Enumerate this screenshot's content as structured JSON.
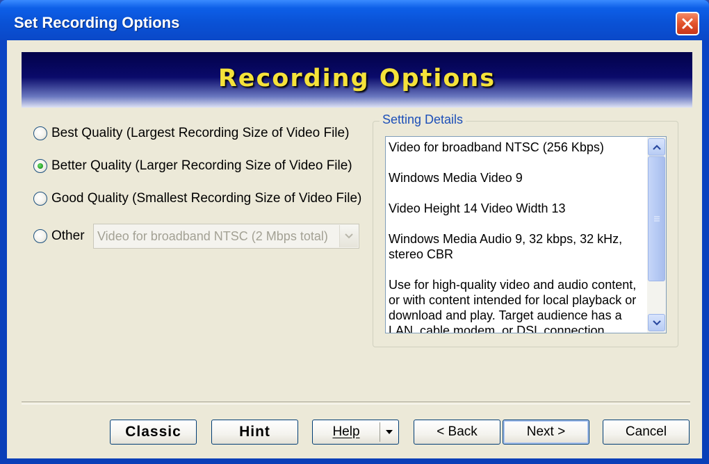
{
  "window": {
    "title": "Set Recording Options"
  },
  "banner": {
    "title": "Recording Options"
  },
  "options": {
    "best": {
      "label": "Best Quality (Largest Recording Size of Video File)",
      "selected": false
    },
    "better": {
      "label": "Better Quality (Larger Recording Size of Video File)",
      "selected": true
    },
    "good": {
      "label": "Good Quality (Smallest Recording Size of Video File)",
      "selected": false
    },
    "other": {
      "label": "Other",
      "selected": false,
      "combo_value": "Video for broadband NTSC (2 Mbps total)"
    }
  },
  "details": {
    "label": "Setting Details",
    "lines": [
      "Video for broadband NTSC (256 Kbps)",
      "Windows Media Video 9",
      "Video Height 14  Video Width 13",
      "Windows Media Audio 9, 32 kbps, 32 kHz, stereo CBR",
      "Use for high-quality video and audio content, or with content intended for local playback or download and play. Target audience has a LAN, cable modem, or DSL connection."
    ]
  },
  "buttons": {
    "classic": "Classic",
    "hint": "Hint",
    "help": "Help",
    "back": "< Back",
    "next": "Next >",
    "cancel": "Cancel"
  },
  "icons": {
    "close": "close-icon",
    "dropdown": "chevron-down-icon",
    "scroll_up": "arrow-up-icon",
    "scroll_down": "arrow-down-icon"
  },
  "colors": {
    "titlebar": "#0a52d6",
    "banner_text": "#f5e23a",
    "group_label": "#1c4fb8"
  }
}
